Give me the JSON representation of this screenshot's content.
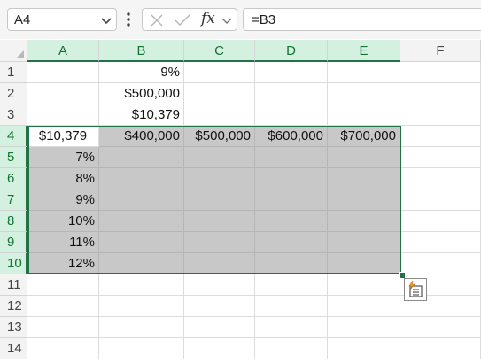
{
  "formula_bar": {
    "name_box": "A4",
    "fx_label": "fx",
    "formula": "=B3",
    "icons": {
      "dropdown": "chevron-down-icon",
      "more": "vertical-dots-icon",
      "cancel": "close-icon",
      "enter": "check-icon",
      "fx_dropdown": "chevron-down-icon"
    }
  },
  "columns": [
    "A",
    "B",
    "C",
    "D",
    "E",
    "F"
  ],
  "rows": [
    "1",
    "2",
    "3",
    "4",
    "5",
    "6",
    "7",
    "8",
    "9",
    "10",
    "11",
    "12",
    "13",
    "14"
  ],
  "cells": {
    "B1": "9%",
    "B2": "$500,000",
    "B3": "$10,379",
    "A4": "$10,379",
    "B4": "$400,000",
    "C4": "$500,000",
    "D4": "$600,000",
    "E4": "$700,000",
    "A5": "7%",
    "A6": "8%",
    "A7": "9%",
    "A8": "10%",
    "A9": "11%",
    "A10": "12%"
  },
  "selection": {
    "active_cell": "A4",
    "range": "A4:E10"
  },
  "quick_analysis_icon": "quick-analysis-icon",
  "colors": {
    "accent": "#217346",
    "shaded_fill": "#c8c8c8",
    "header_selected_fill": "#d3f0e0"
  }
}
